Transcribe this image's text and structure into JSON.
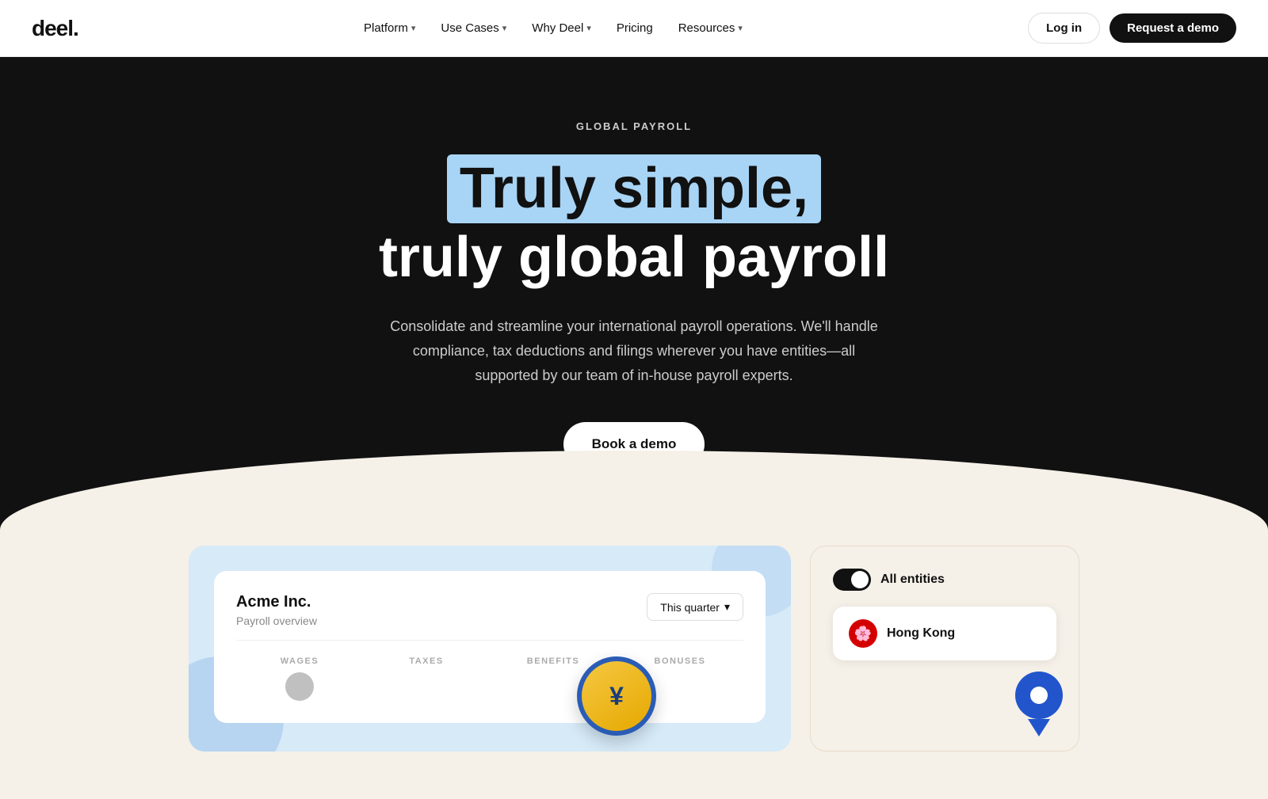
{
  "nav": {
    "logo": "deel.",
    "items": [
      {
        "label": "Platform",
        "hasDropdown": true
      },
      {
        "label": "Use Cases",
        "hasDropdown": true
      },
      {
        "label": "Why Deel",
        "hasDropdown": true
      },
      {
        "label": "Pricing",
        "hasDropdown": false
      },
      {
        "label": "Resources",
        "hasDropdown": true
      }
    ],
    "login_label": "Log in",
    "demo_label": "Request a demo"
  },
  "hero": {
    "label": "GLOBAL PAYROLL",
    "headline_part1": "Truly simple,",
    "headline_part2": "truly global payroll",
    "description": "Consolidate and streamline your international payroll operations. We'll handle compliance, tax deductions and filings wherever you have entities—all supported by our team of in-house payroll experts.",
    "cta_label": "Book a demo"
  },
  "payroll_card": {
    "company": "Acme Inc.",
    "subtitle": "Payroll overview",
    "quarter_label": "This quarter",
    "columns": [
      "WAGES",
      "TAXES",
      "BENEFITS",
      "BONUSES"
    ]
  },
  "entities_card": {
    "toggle_label": "All entities",
    "location_name": "Hong Kong"
  }
}
